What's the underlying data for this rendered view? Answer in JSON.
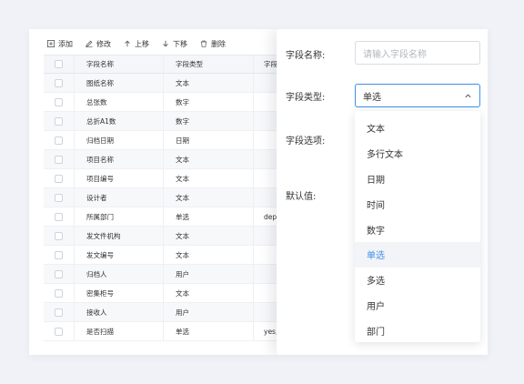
{
  "toolbar": {
    "add": "添加",
    "edit": "修改",
    "move_up": "上移",
    "move_down": "下移",
    "delete": "删除"
  },
  "table": {
    "headers": [
      "字段名称",
      "字段类型",
      "字段"
    ],
    "rows": [
      {
        "name": "图纸名称",
        "type": "文本",
        "extra": ""
      },
      {
        "name": "总张数",
        "type": "数字",
        "extra": ""
      },
      {
        "name": "总折A1数",
        "type": "数字",
        "extra": ""
      },
      {
        "name": "归档日期",
        "type": "日期",
        "extra": ""
      },
      {
        "name": "项目名称",
        "type": "文本",
        "extra": ""
      },
      {
        "name": "项目编号",
        "type": "文本",
        "extra": ""
      },
      {
        "name": "设计者",
        "type": "文本",
        "extra": ""
      },
      {
        "name": "所属部门",
        "type": "单选",
        "extra": "dept"
      },
      {
        "name": "发文件机构",
        "type": "文本",
        "extra": ""
      },
      {
        "name": "发文编号",
        "type": "文本",
        "extra": ""
      },
      {
        "name": "归档人",
        "type": "用户",
        "extra": ""
      },
      {
        "name": "密集柜号",
        "type": "文本",
        "extra": ""
      },
      {
        "name": "接收人",
        "type": "用户",
        "extra": ""
      },
      {
        "name": "是否扫描",
        "type": "单选",
        "extra": "yes;"
      }
    ]
  },
  "form": {
    "field_name_label": "字段名称:",
    "field_name_placeholder": "请输入字段名称",
    "field_type_label": "字段类型:",
    "field_type_value": "单选",
    "field_options_label": "字段选项:",
    "default_label": "默认值:"
  },
  "dropdown": {
    "options": [
      "文本",
      "多行文本",
      "日期",
      "时间",
      "数字",
      "单选",
      "多选",
      "用户",
      "部门"
    ],
    "selected": "单选"
  },
  "colors": {
    "accent": "#3c8ee8",
    "background": "#f0f2f7"
  }
}
